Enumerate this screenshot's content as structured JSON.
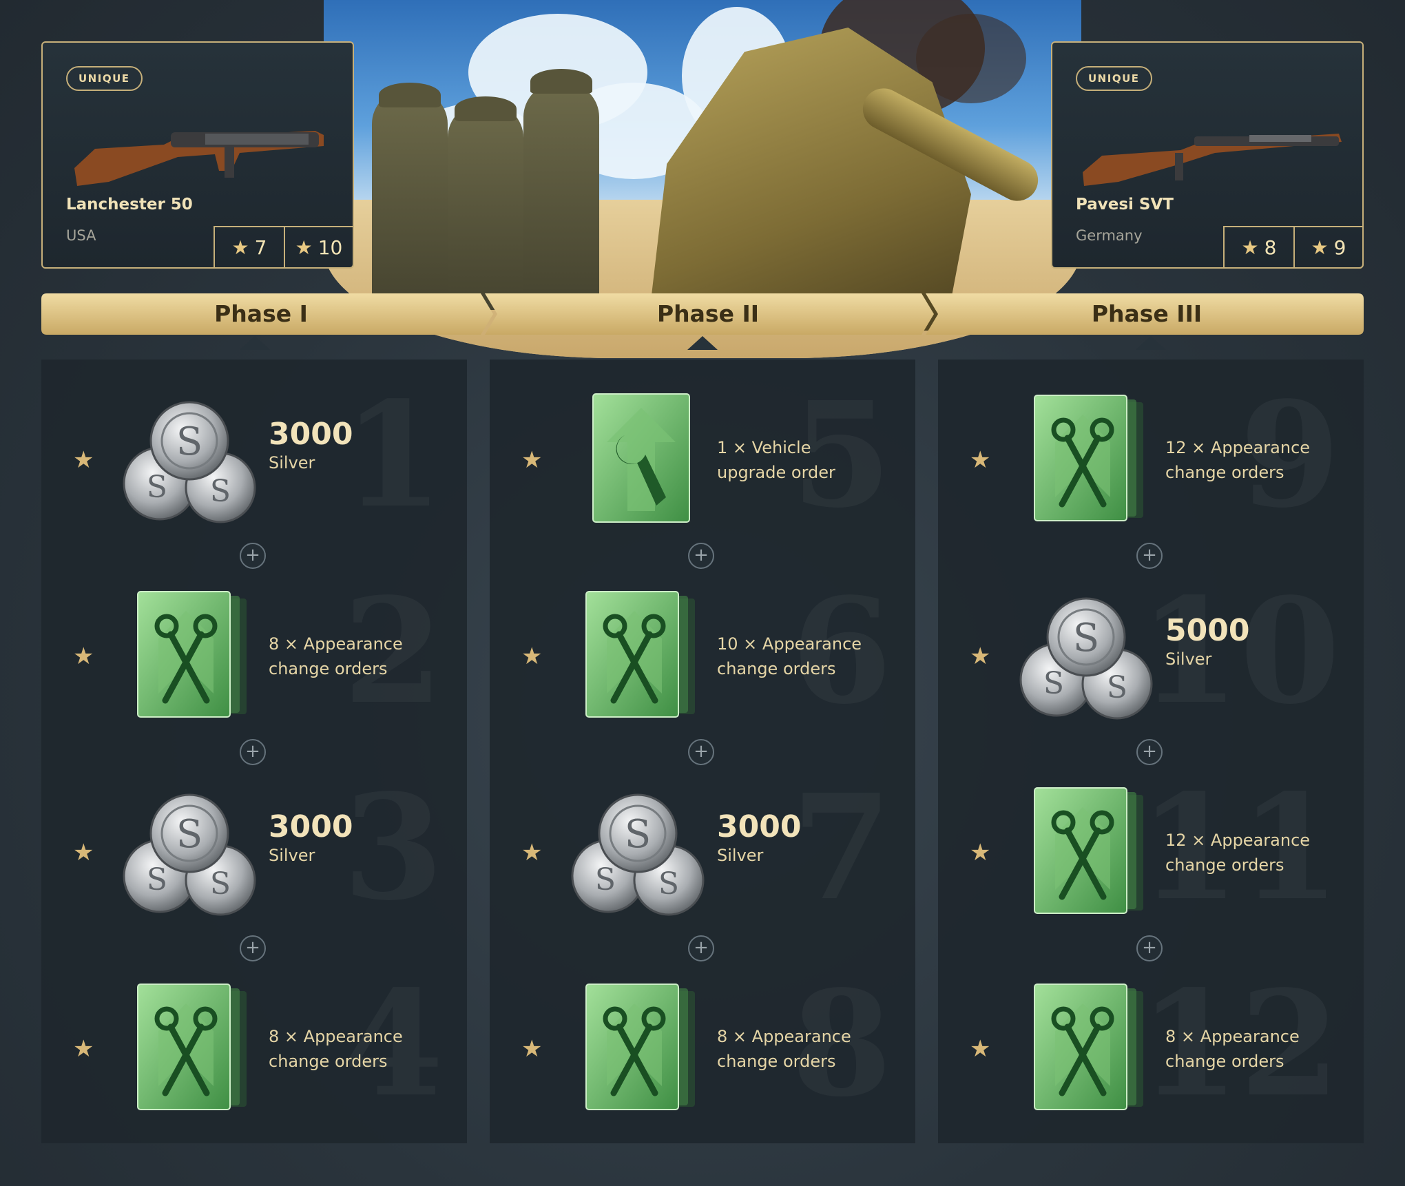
{
  "weapons": [
    {
      "badge": "UNIQUE",
      "name": "Lanchester 50",
      "nation": "USA",
      "stars": [
        "7",
        "10"
      ]
    },
    {
      "badge": "UNIQUE",
      "name": "Pavesi SVT",
      "nation": "Germany",
      "stars": [
        "8",
        "9"
      ]
    }
  ],
  "phases": [
    "Phase I",
    "Phase II",
    "Phase III"
  ],
  "columns": [
    {
      "cells": [
        {
          "num": "1",
          "icon": "silver",
          "amount": "3000",
          "label": "Silver"
        },
        {
          "num": "2",
          "icon": "appearance",
          "count": "8",
          "line1": "Appearance",
          "line2": "change orders"
        },
        {
          "num": "3",
          "icon": "silver",
          "amount": "3000",
          "label": "Silver"
        },
        {
          "num": "4",
          "icon": "appearance",
          "count": "8",
          "line1": "Appearance",
          "line2": "change orders"
        }
      ]
    },
    {
      "cells": [
        {
          "num": "5",
          "icon": "upgrade",
          "count": "1",
          "line1": "Vehicle",
          "line2": "upgrade order"
        },
        {
          "num": "6",
          "icon": "appearance",
          "count": "10",
          "line1": "Appearance",
          "line2": "change orders"
        },
        {
          "num": "7",
          "icon": "silver",
          "amount": "3000",
          "label": "Silver"
        },
        {
          "num": "8",
          "icon": "appearance",
          "count": "8",
          "line1": "Appearance",
          "line2": "change orders"
        }
      ]
    },
    {
      "cells": [
        {
          "num": "9",
          "icon": "appearance",
          "count": "12",
          "line1": "Appearance",
          "line2": "change orders"
        },
        {
          "num": "10",
          "icon": "silver",
          "amount": "5000",
          "label": "Silver"
        },
        {
          "num": "11",
          "icon": "appearance",
          "count": "12",
          "line1": "Appearance",
          "line2": "change orders"
        },
        {
          "num": "12",
          "icon": "appearance",
          "count": "8",
          "line1": "Appearance",
          "line2": "change orders"
        }
      ]
    }
  ],
  "colors": {
    "gold": "#c7b07a",
    "ribbon": "#e2c68a",
    "green": "#6cbf6a",
    "panel": "#1e272e"
  }
}
